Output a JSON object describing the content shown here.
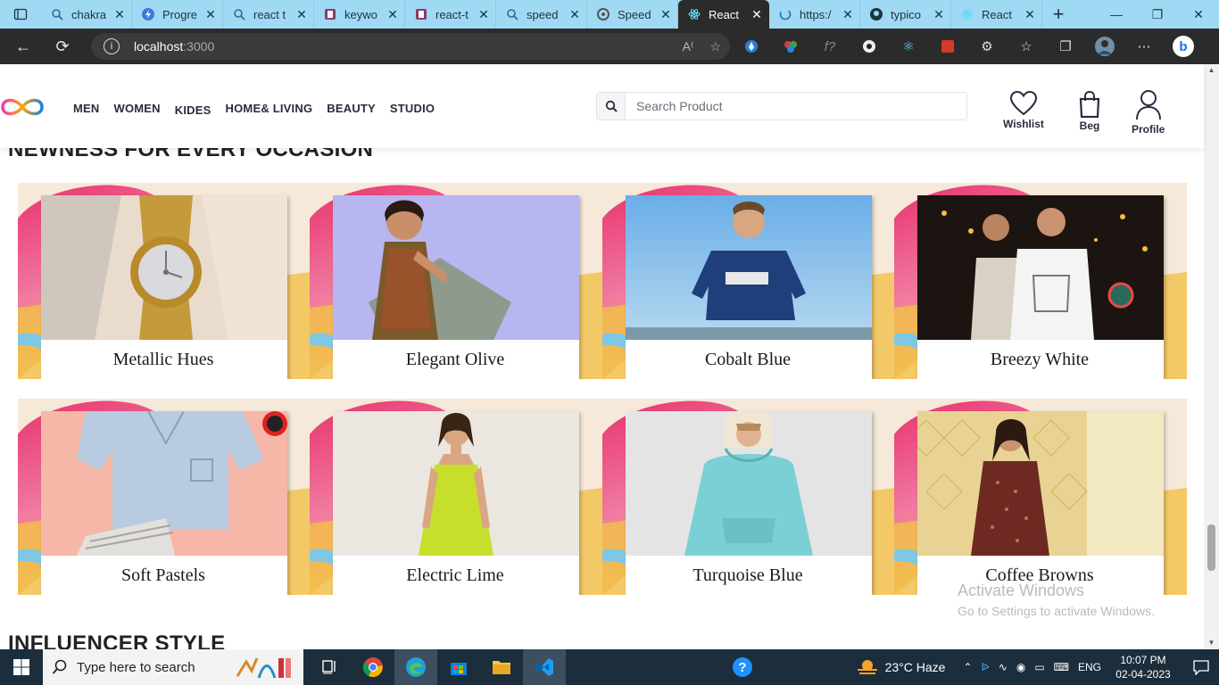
{
  "browser": {
    "tabs": [
      {
        "title": "chakra",
        "icon": "search-icon"
      },
      {
        "title": "Progre",
        "icon": "bolt-icon"
      },
      {
        "title": "react t",
        "icon": "search-icon"
      },
      {
        "title": "keywo",
        "icon": "bookmark-icon"
      },
      {
        "title": "react-t",
        "icon": "bookmark-icon"
      },
      {
        "title": "speed",
        "icon": "search-icon"
      },
      {
        "title": "Speed",
        "icon": "circle-icon"
      },
      {
        "title": "React",
        "icon": "react-icon",
        "active": true
      },
      {
        "title": "https:/",
        "icon": "loading-icon"
      },
      {
        "title": "typico",
        "icon": "github-icon"
      },
      {
        "title": "React",
        "icon": "react-icon"
      }
    ],
    "url_host": "localhost",
    "url_port": ":3000"
  },
  "header": {
    "nav": [
      "MEN",
      "WOMEN",
      "KIDES",
      "HOME& LIVING",
      "BEAUTY",
      "STUDIO"
    ],
    "search_placeholder": "Search Product",
    "wishlist": "Wishlist",
    "bag": "Beg",
    "profile": "Profile"
  },
  "sections": {
    "title1": "NEWNESS FOR EVERY OCCASION",
    "title2": "INFLUENCER STYLE"
  },
  "cards": [
    {
      "label": "Metallic Hues",
      "photo": "watch"
    },
    {
      "label": "Elegant Olive",
      "photo": "olive-dress"
    },
    {
      "label": "Cobalt Blue",
      "photo": "blue-tee"
    },
    {
      "label": "Breezy White",
      "photo": "white-tee"
    },
    {
      "label": "Soft Pastels",
      "photo": "pastel-shirt"
    },
    {
      "label": "Electric Lime",
      "photo": "lime-dress"
    },
    {
      "label": "Turquoise Blue",
      "photo": "hoodie"
    },
    {
      "label": "Coffee Browns",
      "photo": "brown-kurta"
    }
  ],
  "watermark": {
    "line1": "Activate Windows",
    "line2": "Go to Settings to activate Windows."
  },
  "taskbar": {
    "search_placeholder": "Type here to search",
    "weather": "23°C  Haze",
    "lang": "ENG",
    "time": "10:07 PM",
    "date": "02-04-2023"
  },
  "colors": {
    "tabstrip": "#9fd9f4",
    "chrome_dark": "#2b2b2b",
    "taskbar": "#1c2d3c",
    "card_pink": "#e8336d",
    "card_yellow": "#f2c14a",
    "card_wave": "#7fc8e3"
  }
}
